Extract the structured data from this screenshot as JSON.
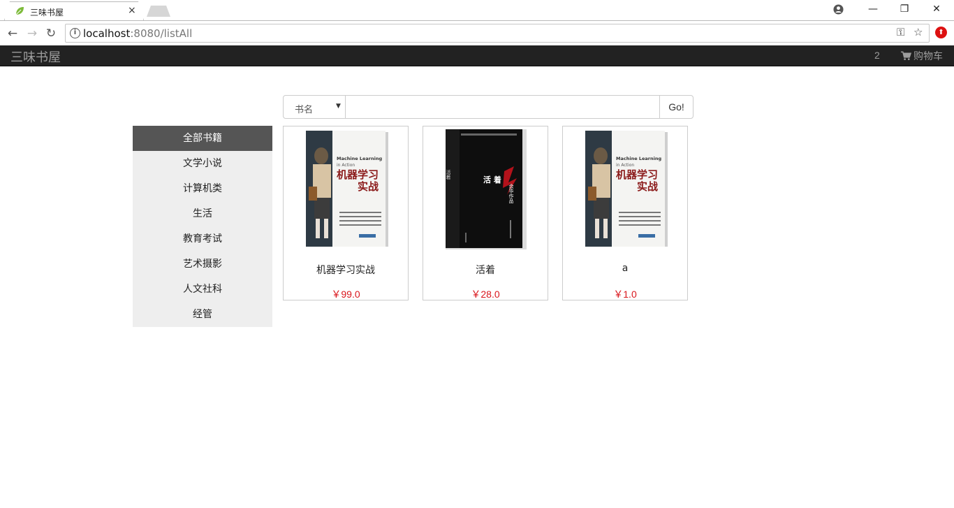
{
  "browser": {
    "tab_title": "三味书屋",
    "tab_close": "×",
    "url_host": "localhost",
    "url_rest": ":8080/listAll",
    "controls": {
      "minimize": "—",
      "maximize": "❐",
      "close": "✕"
    }
  },
  "navbar": {
    "brand": "三味书屋",
    "cart_count": "2",
    "cart_label": "购物车"
  },
  "search": {
    "field_selected": "书名",
    "query": "",
    "submit_label": "Go!"
  },
  "sidebar": {
    "items": [
      {
        "label": "全部书籍",
        "active": true
      },
      {
        "label": "文学小说"
      },
      {
        "label": "计算机类"
      },
      {
        "label": "生活"
      },
      {
        "label": "教育考试"
      },
      {
        "label": "艺术摄影"
      },
      {
        "label": "人文社科"
      },
      {
        "label": "经管"
      }
    ]
  },
  "products": [
    {
      "name": "机器学习实战",
      "price": "￥99.0",
      "cover": {
        "title_en": "Machine Learning",
        "subtitle_en": "in Action",
        "title_cn_1": "机器学习",
        "title_cn_2": "实战"
      }
    },
    {
      "name": "活着",
      "price": "￥28.0",
      "cover": {
        "title_cn": "活 着",
        "author": "余华作品",
        "side_title": "活着"
      }
    },
    {
      "name": "a",
      "price": "￥1.0",
      "cover": {
        "title_en": "Machine Learning",
        "subtitle_en": "in Action",
        "title_cn_1": "机器学习",
        "title_cn_2": "实战"
      }
    }
  ],
  "colors": {
    "navbar_bg": "#222222",
    "navbar_text": "#9d9d9d",
    "sidebar_bg": "#eeeeee",
    "sidebar_active": "#555555",
    "price": "#d9161c"
  }
}
